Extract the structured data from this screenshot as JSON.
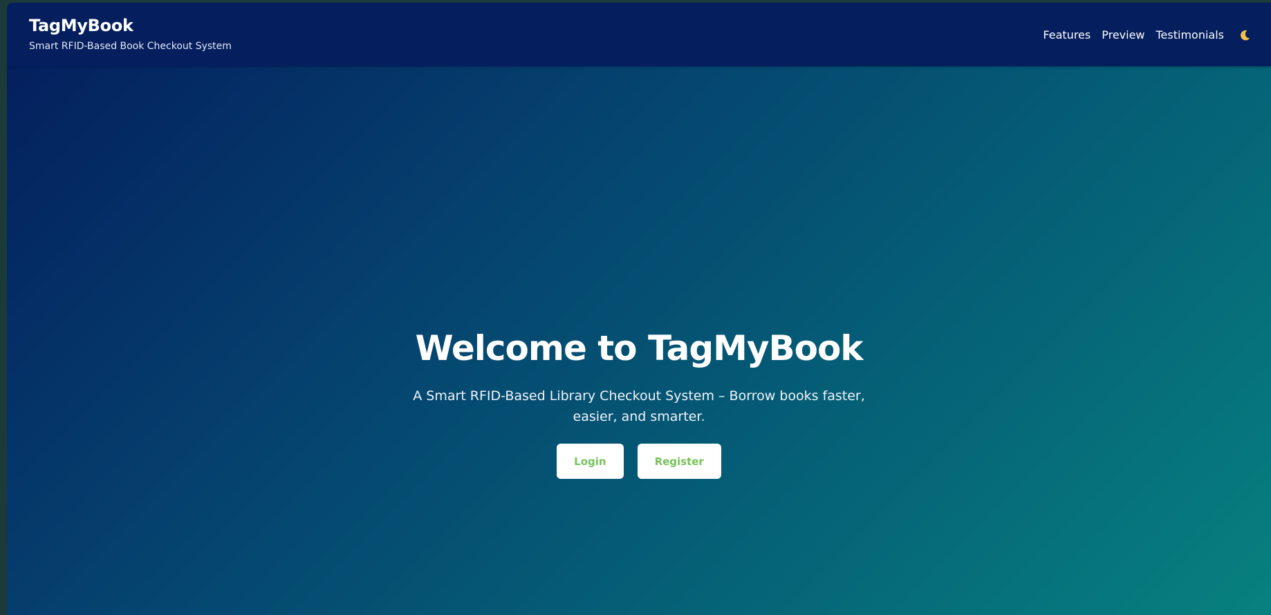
{
  "brand": {
    "name": "TagMyBook",
    "tagline": "Smart RFID-Based Book Checkout System"
  },
  "nav": {
    "links": [
      {
        "label": "Features"
      },
      {
        "label": "Preview"
      },
      {
        "label": "Testimonials"
      }
    ],
    "theme_toggle_icon": "moon-icon"
  },
  "hero": {
    "title": "Welcome to TagMyBook",
    "subtitle": "A Smart RFID-Based Library Checkout System – Borrow books faster, easier, and smarter.",
    "login_label": "Login",
    "register_label": "Register"
  },
  "colors": {
    "navbar_bg": "#041e5e",
    "gradient_start": "#041c5c",
    "gradient_end": "#07817f",
    "button_text": "#77c35a",
    "moon": "#f5c04a"
  }
}
